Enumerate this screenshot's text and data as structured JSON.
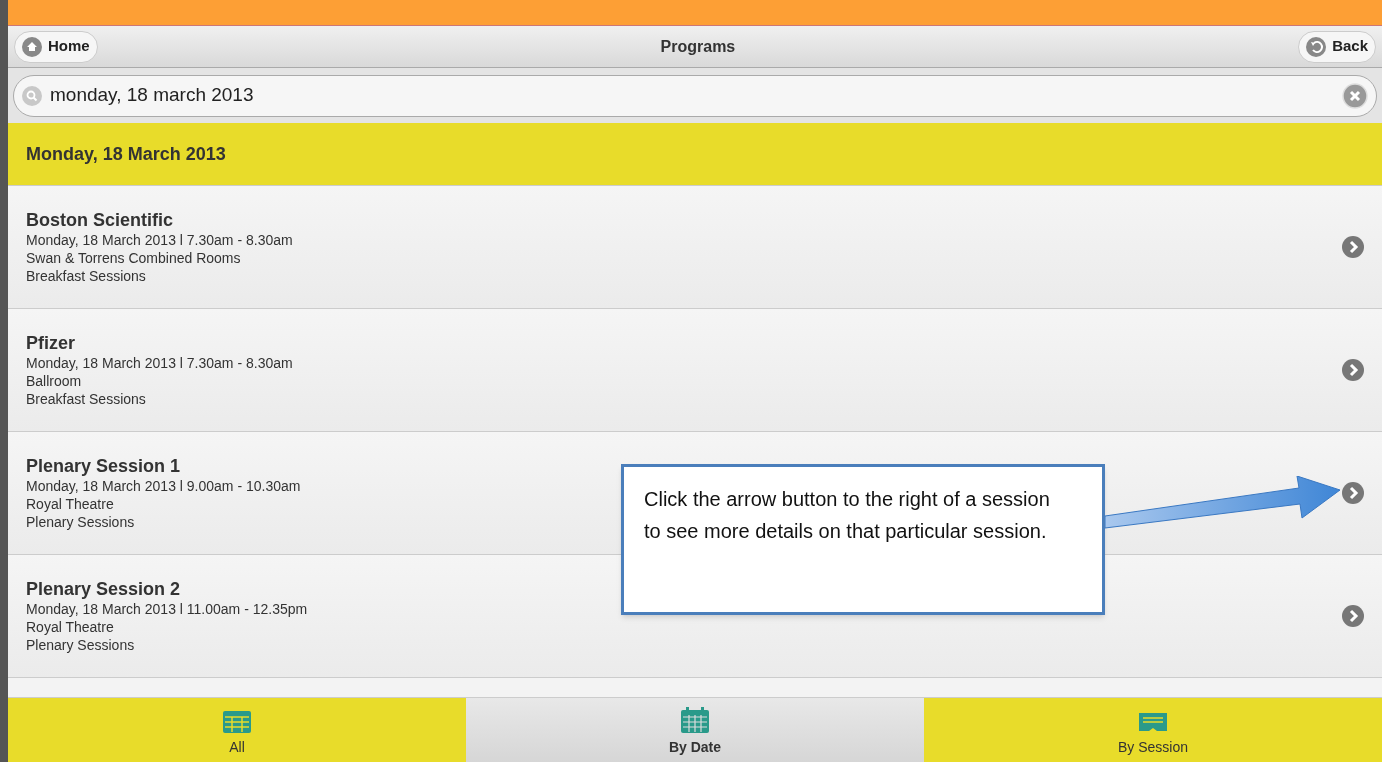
{
  "header": {
    "home_button": "Home",
    "title": "Programs",
    "back_button": "Back"
  },
  "search": {
    "value": "monday, 18 march 2013"
  },
  "date_heading": "Monday, 18 March 2013",
  "sessions": [
    {
      "title": "Boston Scientific",
      "when": "Monday, 18 March 2013 l 7.30am - 8.30am",
      "room": "Swan & Torrens Combined Rooms",
      "category": "Breakfast Sessions"
    },
    {
      "title": "Pfizer",
      "when": "Monday, 18 March 2013 l 7.30am - 8.30am",
      "room": "Ballroom",
      "category": "Breakfast Sessions"
    },
    {
      "title": "Plenary Session 1",
      "when": "Monday, 18 March 2013 l 9.00am - 10.30am",
      "room": "Royal Theatre",
      "category": "Plenary Sessions"
    },
    {
      "title": "Plenary Session 2",
      "when": "Monday, 18 March 2013 l 11.00am - 12.35pm",
      "room": "Royal Theatre",
      "category": "Plenary Sessions"
    }
  ],
  "callout": {
    "text": "Click the arrow button to the right of a session to see more details on that particular session."
  },
  "tabs": [
    {
      "label": "All",
      "kind": "grid",
      "selected": false
    },
    {
      "label": "By Date",
      "kind": "calendar",
      "selected": true
    },
    {
      "label": "By Session",
      "kind": "ticket",
      "selected": false
    }
  ]
}
